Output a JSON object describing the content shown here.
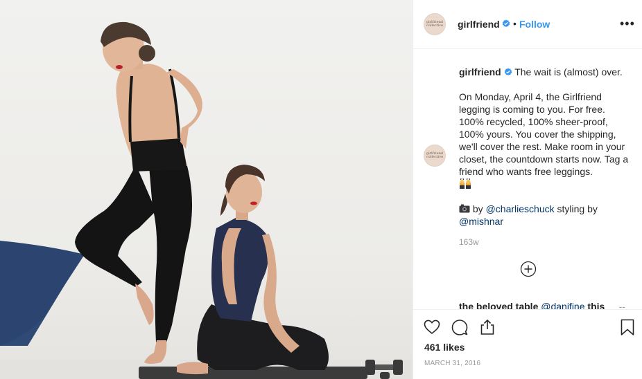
{
  "post": {
    "image_alt": "Two models in black leggings posing against a white wall"
  },
  "header": {
    "avatar_text": "girlfriend collective",
    "username": "girlfriend",
    "separator": "•",
    "follow_label": "Follow",
    "more_label": "•••"
  },
  "caption": {
    "username": "girlfriend",
    "line1": "The wait is (almost) over.",
    "para2": "On Monday, April 4, the Girlfriend legging is coming to you. For free. 100% recycled, 100% sheer-proof, 100% yours. You cover the shipping, we'll cover the rest. Make room in your closet, the countdown starts now. Tag a friend who wants free leggings.",
    "emoji_name": "people-with-bunny-ears-emoji",
    "credit_by": "by",
    "credit_photographer": "@charlieschuck",
    "credit_styling": "styling by",
    "credit_stylist": "@mishnar",
    "time_ago": "163w"
  },
  "next_comment": {
    "text": "the beloved table",
    "mention": "@danifine",
    "tail": "this",
    "dash": "--"
  },
  "actions": {
    "icons": [
      "heart-icon",
      "comment-icon",
      "share-icon",
      "bookmark-icon"
    ],
    "likes": "461 likes",
    "date": "MARCH 31, 2016"
  },
  "colors": {
    "link": "#3897f0",
    "mention": "#003569",
    "verified": "#3897f0",
    "muted": "#999999"
  }
}
